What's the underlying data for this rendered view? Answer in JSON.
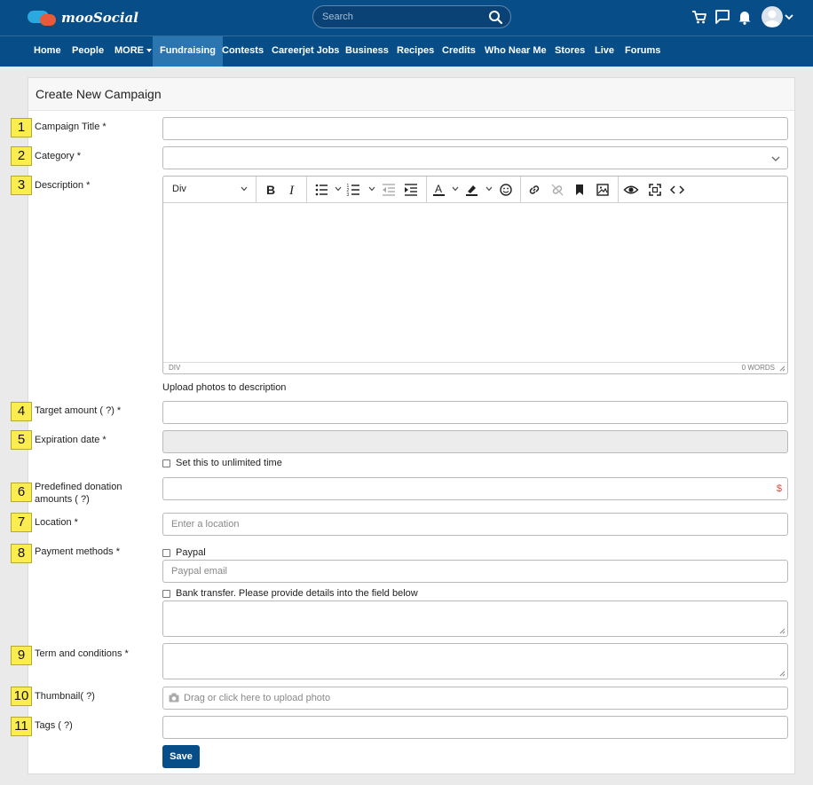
{
  "header": {
    "logo_text": "mooSocial",
    "search_placeholder": "Search",
    "icons": [
      "cart-icon",
      "chat-icon",
      "bell-icon",
      "avatar",
      "chevron-down-icon"
    ]
  },
  "nav": {
    "items": [
      {
        "label": "Home"
      },
      {
        "label": "People"
      },
      {
        "label": "MORE"
      },
      {
        "label": "Fundraising",
        "active": true
      },
      {
        "label": "Contests"
      },
      {
        "label": "Careerjet Jobs"
      },
      {
        "label": "Business"
      },
      {
        "label": "Recipes"
      },
      {
        "label": "Credits"
      },
      {
        "label": "Who Near Me"
      },
      {
        "label": "Stores"
      },
      {
        "label": "Live"
      },
      {
        "label": "Forums"
      }
    ]
  },
  "form": {
    "title": "Create New Campaign",
    "fields": {
      "campaign_title": {
        "num": "1",
        "label": "Campaign Title *"
      },
      "category": {
        "num": "2",
        "label": "Category *"
      },
      "description": {
        "num": "3",
        "label": "Description *"
      },
      "target_amount": {
        "num": "4",
        "label": "Target amount ( ?) *"
      },
      "expiration_date": {
        "num": "5",
        "label": "Expiration date *",
        "unlimited_label": "Set this to unlimited time"
      },
      "predefined": {
        "num": "6",
        "label_line1": "Predefined donation",
        "label_line2": "amounts ( ?)",
        "currency": "$"
      },
      "location": {
        "num": "7",
        "label": "Location *",
        "placeholder": "Enter a location"
      },
      "payment": {
        "num": "8",
        "label": "Payment methods *",
        "paypal_label": "Paypal",
        "paypal_placeholder": "Paypal email",
        "bank_label": "Bank transfer. Please provide details into the field below"
      },
      "terms": {
        "num": "9",
        "label": "Term and conditions *"
      },
      "thumbnail": {
        "num": "10",
        "label": "Thumbnail( ?)",
        "upload_text": "Drag or click here to upload photo"
      },
      "tags": {
        "num": "11",
        "label": "Tags ( ?)"
      }
    },
    "editor": {
      "block_format": "Div",
      "status_path": "DIV",
      "word_count": "0 WORDS",
      "upload_photos": "Upload photos to description"
    },
    "save_label": "Save"
  }
}
